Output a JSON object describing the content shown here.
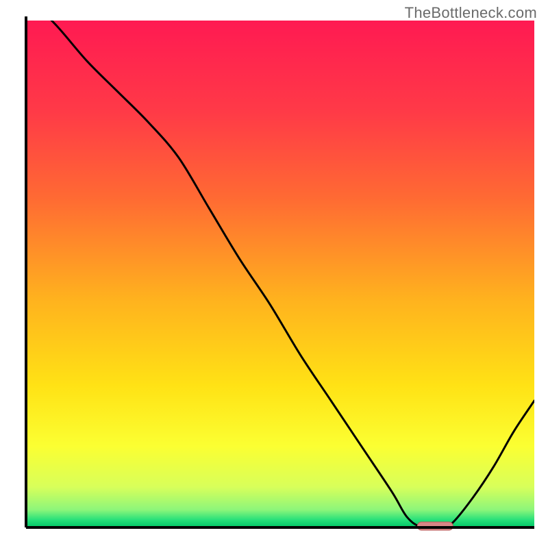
{
  "attribution": "TheBottleneck.com",
  "colors": {
    "axis": "#000000",
    "line": "#000000",
    "marker_fill": "#d88686",
    "marker_stroke": "#bb5a5a",
    "gradient_stops": [
      {
        "offset": 0.0,
        "hex": "#ff1a52"
      },
      {
        "offset": 0.18,
        "hex": "#ff3a47"
      },
      {
        "offset": 0.35,
        "hex": "#ff6a33"
      },
      {
        "offset": 0.55,
        "hex": "#ffb21e"
      },
      {
        "offset": 0.72,
        "hex": "#ffe215"
      },
      {
        "offset": 0.84,
        "hex": "#fbff32"
      },
      {
        "offset": 0.92,
        "hex": "#d8ff5a"
      },
      {
        "offset": 0.965,
        "hex": "#8df67a"
      },
      {
        "offset": 0.985,
        "hex": "#27e07a"
      },
      {
        "offset": 1.0,
        "hex": "#00c566"
      }
    ]
  },
  "chart_data": {
    "type": "line",
    "title": "",
    "xlabel": "",
    "ylabel": "",
    "xlim": [
      0,
      100
    ],
    "ylim": [
      0,
      100
    ],
    "x": [
      0,
      6,
      12,
      18,
      24,
      30,
      36,
      42,
      48,
      54,
      60,
      66,
      72,
      75,
      78,
      82,
      84,
      88,
      92,
      96,
      100
    ],
    "y": [
      105,
      99,
      92,
      86,
      80,
      73,
      63,
      53,
      44,
      34,
      25,
      16,
      7,
      2,
      0,
      0,
      1,
      6,
      12,
      19,
      25
    ],
    "marker": {
      "x_start": 77,
      "x_end": 84,
      "y": 0
    }
  }
}
